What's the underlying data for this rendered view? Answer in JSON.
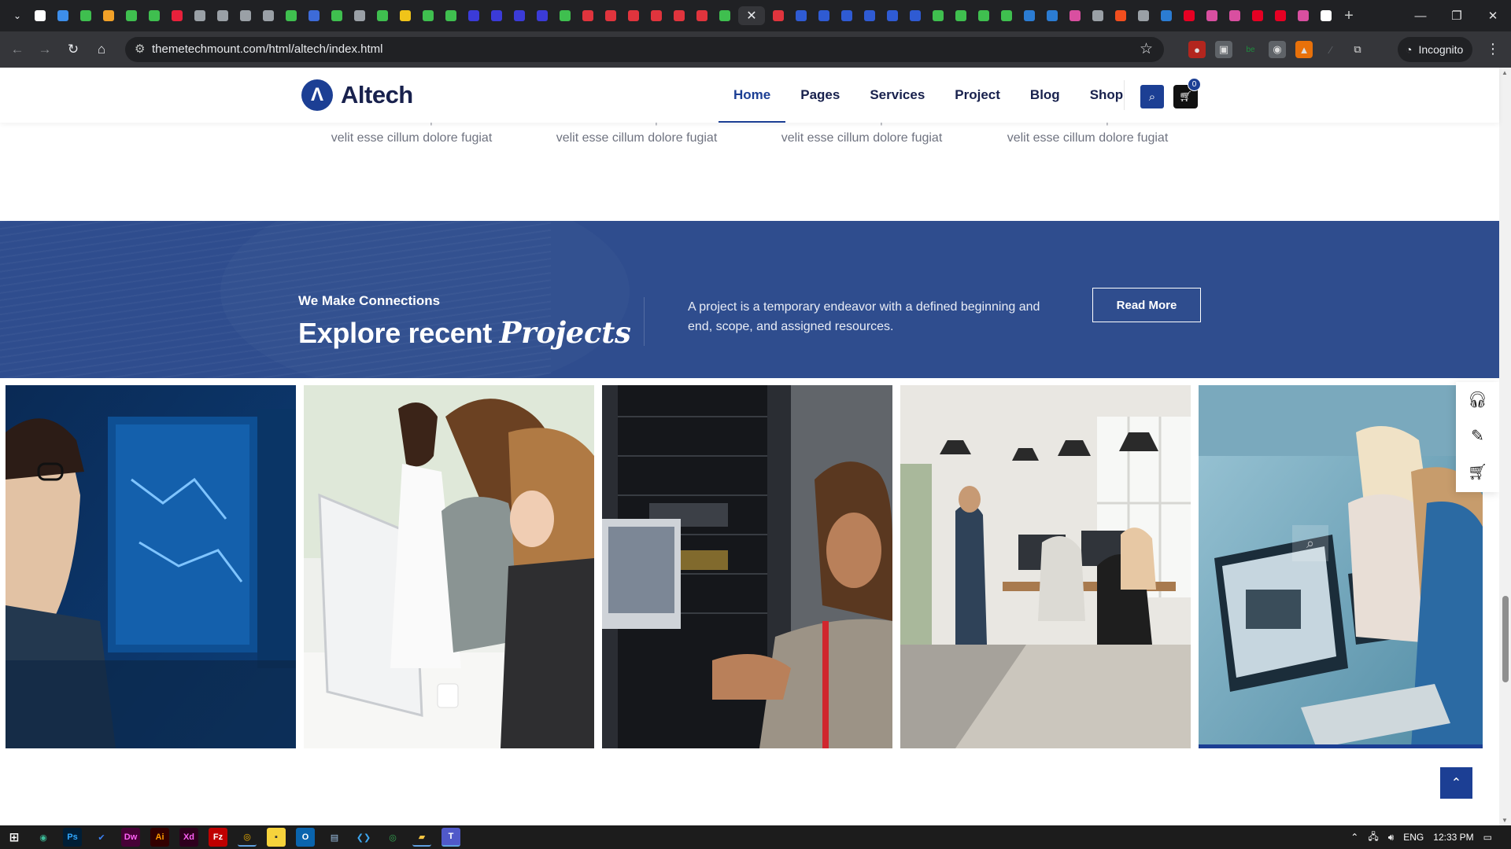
{
  "browser": {
    "url": "themetechmount.com/html/altech/index.html",
    "profile": "Incognito",
    "tab_icon_colors": [
      "#ffffff",
      "#3d8eea",
      "#3fbf4f",
      "#f2a128",
      "#3fbf4f",
      "#3fbf4f",
      "#e8213b",
      "#9aa0a6",
      "#9aa0a6",
      "#9aa0a6",
      "#9aa0a6",
      "#3fbf4f",
      "#3d6bd8",
      "#3fbf4f",
      "#9aa0a6",
      "#3fbf4f",
      "#f0c419",
      "#3fbf4f",
      "#3fbf4f",
      "#3b3bd8",
      "#3b3bd8",
      "#3b3bd8",
      "#3b3bd8",
      "#3fbf4f",
      "#e0343d",
      "#e0343d",
      "#e0343d",
      "#e0343d",
      "#e0343d",
      "#e0343d",
      "#3fbf4f"
    ],
    "tab_icon_colors_right": [
      "#e0343d",
      "#2f5bd3",
      "#2f5bd3",
      "#2f5bd3",
      "#2f5bd3",
      "#2f5bd3",
      "#2f5bd3",
      "#3fbf4f",
      "#3fbf4f",
      "#3fbf4f",
      "#3fbf4f",
      "#2b7cd3",
      "#2b7cd3",
      "#d94fa0",
      "#9aa0a6",
      "#f24e1e",
      "#9aa0a6",
      "#2b7cd3",
      "#e60023",
      "#d94fa0",
      "#d94fa0",
      "#e60023",
      "#e60023",
      "#d94fa0",
      "#ffffff"
    ]
  },
  "site": {
    "logo_text": "Altech",
    "nav": [
      "Home",
      "Pages",
      "Services",
      "Project",
      "Blog",
      "Shop"
    ],
    "active_nav": "Home",
    "cart_count": "0"
  },
  "prev_section": {
    "line1": "Duis irure dolor reprehendent",
    "line2": "velit esse cillum dolore fugiat"
  },
  "banner": {
    "eyebrow": "We Make Connections",
    "title_plain": "Explore recent ",
    "title_italic": "Projects",
    "description": "A project is a temporary endeavor with a defined beginning and end, scope, and assigned resources.",
    "button": "Read More"
  },
  "colors": {
    "brand": "#1c3f94",
    "banner_bg": "#2f4d8e",
    "heading": "#18214d"
  },
  "taskbar": {
    "lang": "ENG",
    "time": "12:33 PM"
  }
}
